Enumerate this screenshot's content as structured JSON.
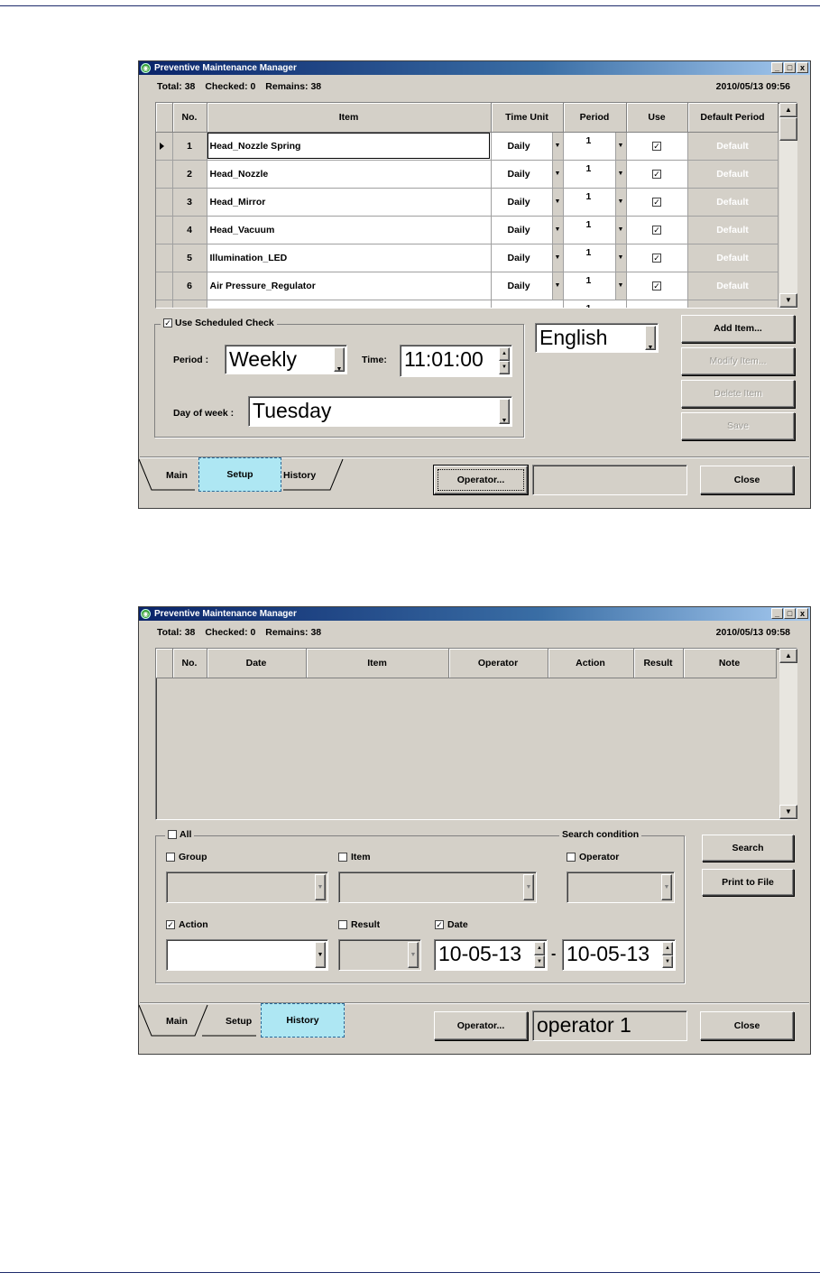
{
  "window_title": "Preventive Maintenance Manager",
  "win_buttons": [
    "_",
    "□",
    "x"
  ],
  "setup": {
    "status": {
      "total": "Total: 38",
      "checked": "Checked: 0",
      "remains": "Remains: 38"
    },
    "datetime": "2010/05/13 09:56",
    "columns": [
      "No.",
      "Item",
      "Time Unit",
      "Period",
      "Use",
      "Default Period"
    ],
    "rows": [
      {
        "no": "1",
        "item": "Head_Nozzle Spring",
        "unit": "Daily",
        "period": "1",
        "use": true,
        "default": "Default"
      },
      {
        "no": "2",
        "item": "Head_Nozzle",
        "unit": "Daily",
        "period": "1",
        "use": true,
        "default": "Default"
      },
      {
        "no": "3",
        "item": "Head_Mirror",
        "unit": "Daily",
        "period": "1",
        "use": true,
        "default": "Default"
      },
      {
        "no": "4",
        "item": "Head_Vacuum",
        "unit": "Daily",
        "period": "1",
        "use": true,
        "default": "Default"
      },
      {
        "no": "5",
        "item": "Illumination_LED",
        "unit": "Daily",
        "period": "1",
        "use": true,
        "default": "Default"
      },
      {
        "no": "6",
        "item": "Air Pressure_Regulator",
        "unit": "Daily",
        "period": "1",
        "use": true,
        "default": "Default"
      }
    ],
    "partial_row_period": "1",
    "schedule_legend": "Use Scheduled Check",
    "schedule_checked": true,
    "period_label": "Period :",
    "period_value": "Weekly",
    "time_label": "Time:",
    "time_value": "11:01:00",
    "dow_label": "Day of week :",
    "dow_value": "Tuesday",
    "language": "English",
    "buttons": {
      "add": "Add Item...",
      "modify": "Modify Item...",
      "delete": "Delete Item",
      "save": "Save"
    },
    "tabs": [
      "Main",
      "Setup",
      "History"
    ],
    "operator_button": "Operator...",
    "operator_value": "",
    "close": "Close"
  },
  "history": {
    "status": {
      "total": "Total: 38",
      "checked": "Checked: 0",
      "remains": "Remains: 38"
    },
    "datetime": "2010/05/13 09:58",
    "columns": [
      "No.",
      "Date",
      "Item",
      "Operator",
      "Action",
      "Result",
      "Note"
    ],
    "all_label": "All",
    "search_legend": "Search condition",
    "group_label": "Group",
    "item_label": "Item",
    "operator_label": "Operator",
    "action_label": "Action",
    "result_label": "Result",
    "date_label": "Date",
    "action_checked": true,
    "date_checked": true,
    "date_from": "10-05-13",
    "date_sep": "-",
    "date_to": "10-05-13",
    "search_button": "Search",
    "print_button": "Print to File",
    "tabs": [
      "Main",
      "Setup",
      "History"
    ],
    "operator_button": "Operator...",
    "operator_value": "operator 1",
    "close": "Close"
  }
}
